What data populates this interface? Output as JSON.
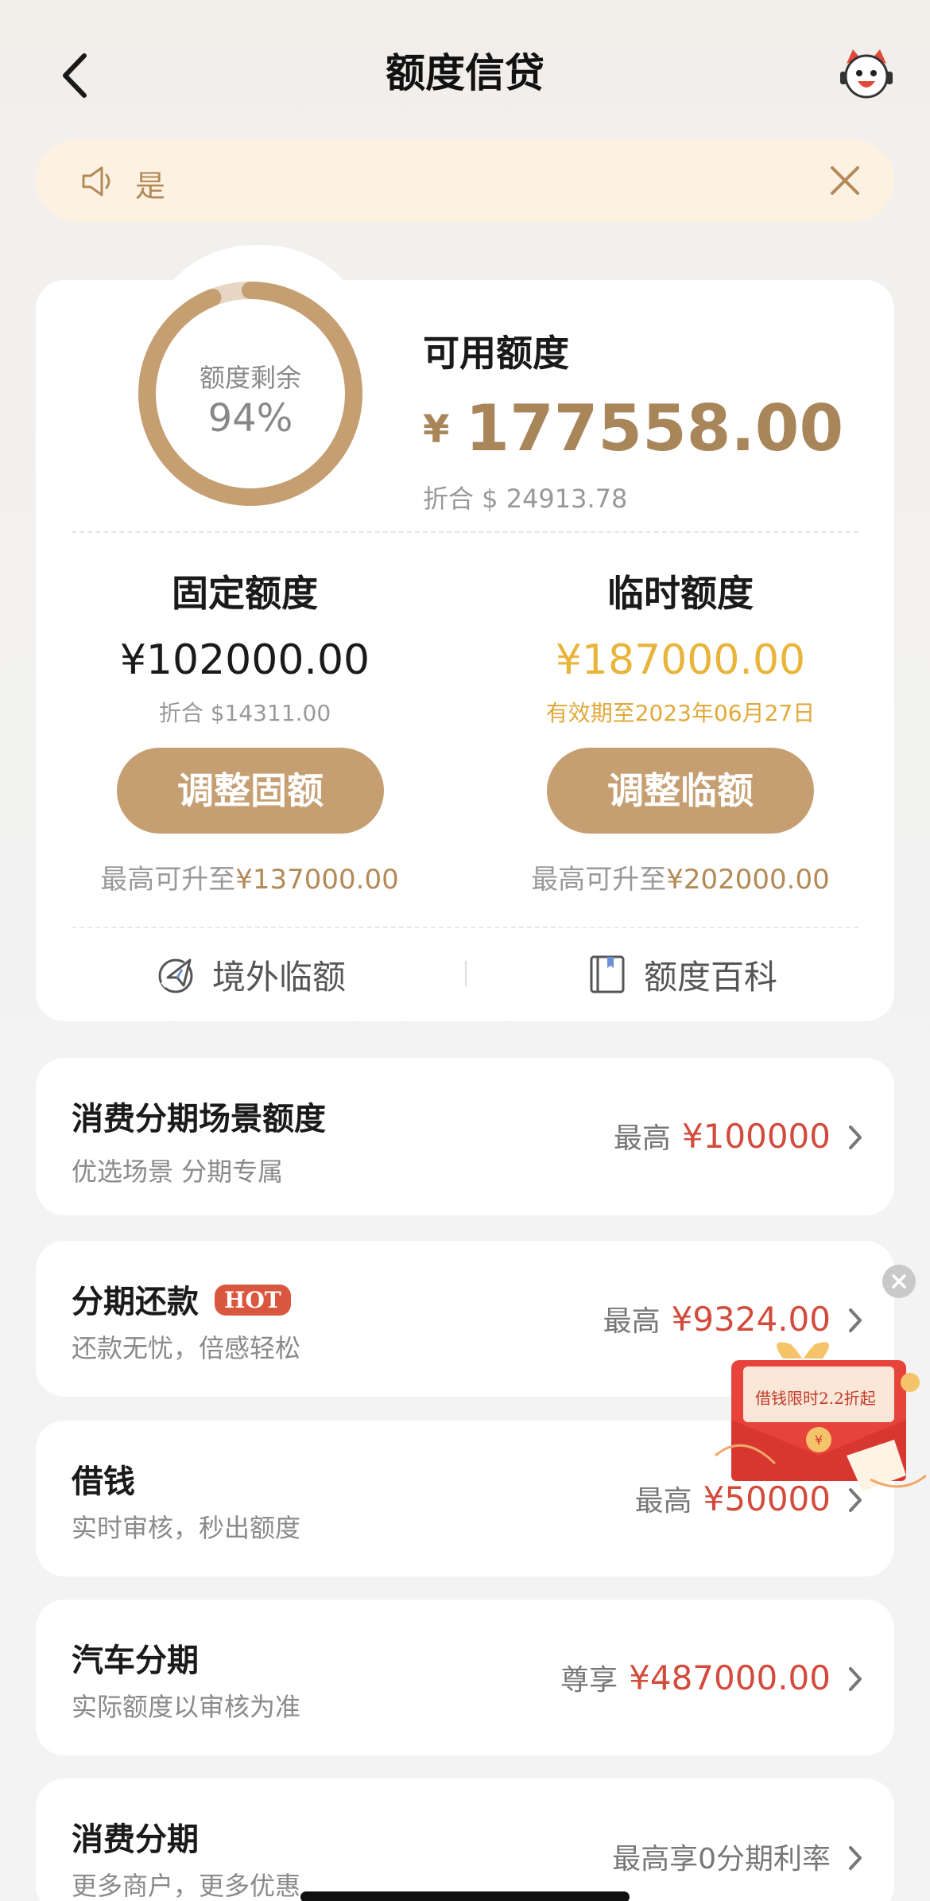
{
  "header": {
    "title": "额度信贷"
  },
  "notice": {
    "text": "是"
  },
  "quota": {
    "ring_label": "额度剩余",
    "ring_percent_text": "94%",
    "remaining_fraction": 0.94,
    "available_label": "可用额度",
    "currency_symbol": "¥",
    "available_amount": "177558.00",
    "available_sub": "折合 $ 24913.78",
    "fixed": {
      "title": "固定额度",
      "amount": "¥102000.00",
      "sub": "折合 $14311.00",
      "button": "调整固额",
      "max_prefix": "最高可升至",
      "max_value": "¥137000.00"
    },
    "temp": {
      "title": "临时额度",
      "amount": "¥187000.00",
      "sub": "有效期至2023年06月27日",
      "button": "调整临额",
      "max_prefix": "最高可升至",
      "max_value": "¥202000.00"
    },
    "links": {
      "overseas": "境外临额",
      "wiki": "额度百科"
    }
  },
  "list": [
    {
      "title": "消费分期场景额度",
      "subtitle": "优选场景 分期专属",
      "prefix": "最高",
      "value": "¥100000"
    },
    {
      "title": "分期还款",
      "badge": "HOT",
      "subtitle": "还款无忧，倍感轻松",
      "prefix": "最高",
      "value": "¥9324.00"
    },
    {
      "title": "借钱",
      "subtitle": "实时审核，秒出额度",
      "prefix": "最高",
      "value": "¥50000"
    },
    {
      "title": "汽车分期",
      "subtitle": "实际额度以审核为准",
      "prefix": "尊享",
      "value": "¥487000.00"
    },
    {
      "title": "消费分期",
      "subtitle": "更多商户，更多优惠",
      "prefix": "最高享0分期利率",
      "value": ""
    }
  ],
  "promo": {
    "text": "借钱限时2.2折起"
  },
  "colors": {
    "accent": "#c59f72",
    "gold_text": "#a9855a",
    "temp_yellow": "#e8b43a",
    "red_value": "#d24b3c",
    "ring_track": "#e6d6c3"
  }
}
